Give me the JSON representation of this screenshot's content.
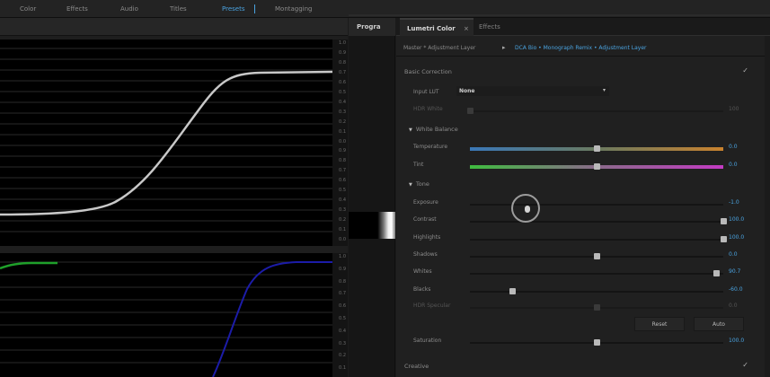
{
  "workspaces": {
    "items": [
      "Color",
      "Effects",
      "Audio",
      "Titles",
      "Presets",
      "Montagging"
    ],
    "active": "Presets"
  },
  "scopes": {
    "scale_top": [
      "1.0",
      "0.9",
      "0.8",
      "0.7",
      "0.6",
      "0.5",
      "0.4",
      "0.3",
      "0.2",
      "0.1",
      "0.0",
      "0.9",
      "0.8",
      "0.7",
      "0.6",
      "0.5",
      "0.4",
      "0.3",
      "0.2",
      "0.1",
      "0.0"
    ],
    "scale_bottom": [
      "1.0",
      "0.9",
      "0.8",
      "0.7",
      "0.6",
      "0.5",
      "0.4",
      "0.3",
      "0.2",
      "0.1"
    ],
    "colors": {
      "luma": "#c8c8c8",
      "green": "#1fa02a",
      "blue": "#1c1ca8"
    }
  },
  "program": {
    "tab_label": "Progra"
  },
  "panel": {
    "tab_active": "Lumetri Color",
    "tab_close": "×",
    "tab_inactive": "Effects",
    "breadcrumb_master": "Master * Adjustment Layer",
    "breadcrumb_sequence": "DCA Bio • Monograph Remix • Adjustment Layer",
    "basic_correction": {
      "title": "Basic Correction",
      "check": "✓"
    },
    "input_lut": {
      "label": "Input LUT",
      "value": "None"
    },
    "hdr_white": {
      "label": "HDR White",
      "value": "100"
    },
    "white_balance": {
      "title": "White Balance"
    },
    "temperature": {
      "label": "Temperature",
      "value": "0.0"
    },
    "tint": {
      "label": "Tint",
      "value": "0.0"
    },
    "tone": {
      "title": "Tone"
    },
    "exposure": {
      "label": "Exposure",
      "value": "-1.0"
    },
    "contrast": {
      "label": "Contrast",
      "value": "100.0"
    },
    "highlights": {
      "label": "Highlights",
      "value": "100.0"
    },
    "shadows": {
      "label": "Shadows",
      "value": "0.0"
    },
    "whites": {
      "label": "Whites",
      "value": "90.7"
    },
    "blacks": {
      "label": "Blacks",
      "value": "-60.0"
    },
    "hdr_specular": {
      "label": "HDR Specular",
      "value": "0.0"
    },
    "reset_button": "Reset",
    "auto_button": "Auto",
    "saturation": {
      "label": "Saturation",
      "value": "100.0"
    },
    "creative": {
      "title": "Creative",
      "check": "✓"
    },
    "tone_triangle": "▼"
  }
}
